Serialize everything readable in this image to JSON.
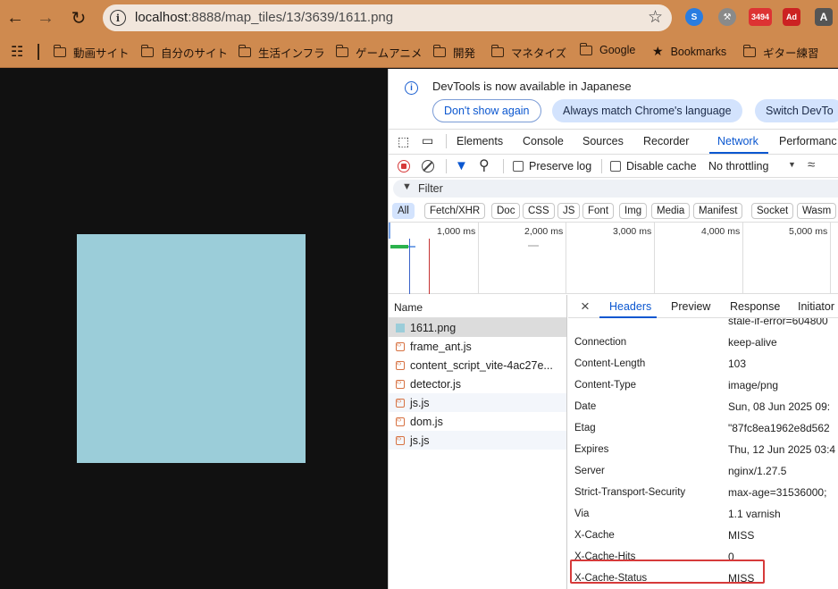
{
  "browser": {
    "url_host": "localhost",
    "url_path": ":8888/map_tiles/13/3639/1611.png",
    "extensions": [
      {
        "icon": "blue-swirl-icon",
        "color": "#2a7de1",
        "label": ""
      },
      {
        "icon": "tools-icon",
        "color": "#8a8a8a",
        "label": ""
      },
      {
        "icon": "mail-badge-icon",
        "color": "#d33",
        "label": "3494"
      },
      {
        "icon": "adblock-icon",
        "color": "#c22",
        "label": "Ad"
      },
      {
        "icon": "profile-icon",
        "color": "#555",
        "label": "A"
      }
    ]
  },
  "bookmarks": [
    {
      "label": "動画サイト",
      "type": "folder"
    },
    {
      "label": "自分のサイト",
      "type": "folder"
    },
    {
      "label": "生活インフラ",
      "type": "folder"
    },
    {
      "label": "ゲームアニメ",
      "type": "folder"
    },
    {
      "label": "開発",
      "type": "folder"
    },
    {
      "label": "マネタイズ",
      "type": "folder"
    },
    {
      "label": "Google",
      "type": "folder"
    },
    {
      "label": "Bookmarks",
      "type": "star"
    },
    {
      "label": "ギター練習",
      "type": "folder"
    }
  ],
  "devtools": {
    "infobar": {
      "message": "DevTools is now available in Japanese",
      "dont_show": "Don't show again",
      "match_lang": "Always match Chrome's language",
      "switch": "Switch DevTo"
    },
    "tabs": [
      "Elements",
      "Console",
      "Sources",
      "Recorder",
      "Network",
      "Performanc"
    ],
    "active_tab": "Network",
    "controls": {
      "preserve_log": "Preserve log",
      "disable_cache": "Disable cache",
      "throttling": "No throttling"
    },
    "filter_placeholder": "Filter",
    "type_filters": [
      "All",
      "Fetch/XHR",
      "Doc",
      "CSS",
      "JS",
      "Font",
      "Img",
      "Media",
      "Manifest",
      "Socket",
      "Wasm"
    ],
    "timeline_labels": [
      "1,000 ms",
      "2,000 ms",
      "3,000 ms",
      "4,000 ms",
      "5,000 ms"
    ],
    "name_header": "Name",
    "requests": [
      {
        "name": "1611.png",
        "type": "img"
      },
      {
        "name": "frame_ant.js",
        "type": "js"
      },
      {
        "name": "content_script_vite-4ac27e...",
        "type": "js"
      },
      {
        "name": "detector.js",
        "type": "js"
      },
      {
        "name": "js.js",
        "type": "js"
      },
      {
        "name": "dom.js",
        "type": "js"
      },
      {
        "name": "js.js",
        "type": "js"
      }
    ],
    "detail_tabs": [
      "Headers",
      "Preview",
      "Response",
      "Initiator"
    ],
    "partial_top": "stale-if-error=604800",
    "headers": [
      {
        "key": "Connection",
        "value": "keep-alive"
      },
      {
        "key": "Content-Length",
        "value": "103"
      },
      {
        "key": "Content-Type",
        "value": "image/png"
      },
      {
        "key": "Date",
        "value": "Sun, 08 Jun 2025 09:"
      },
      {
        "key": "Etag",
        "value": "\"87fc8ea1962e8d562"
      },
      {
        "key": "Expires",
        "value": "Thu, 12 Jun 2025 03:4"
      },
      {
        "key": "Server",
        "value": "nginx/1.27.5"
      },
      {
        "key": "Strict-Transport-Security",
        "value": "max-age=31536000;"
      },
      {
        "key": "Via",
        "value": "1.1 varnish"
      },
      {
        "key": "X-Cache",
        "value": "MISS"
      },
      {
        "key": "X-Cache-Hits",
        "value": "0"
      },
      {
        "key": "X-Cache-Status",
        "value": "MISS"
      }
    ]
  },
  "colors": {
    "chrome": "#cf8a4f",
    "accent": "#0b57d0",
    "tile": "#9bcdd9",
    "highlight": "#d63a3a"
  }
}
